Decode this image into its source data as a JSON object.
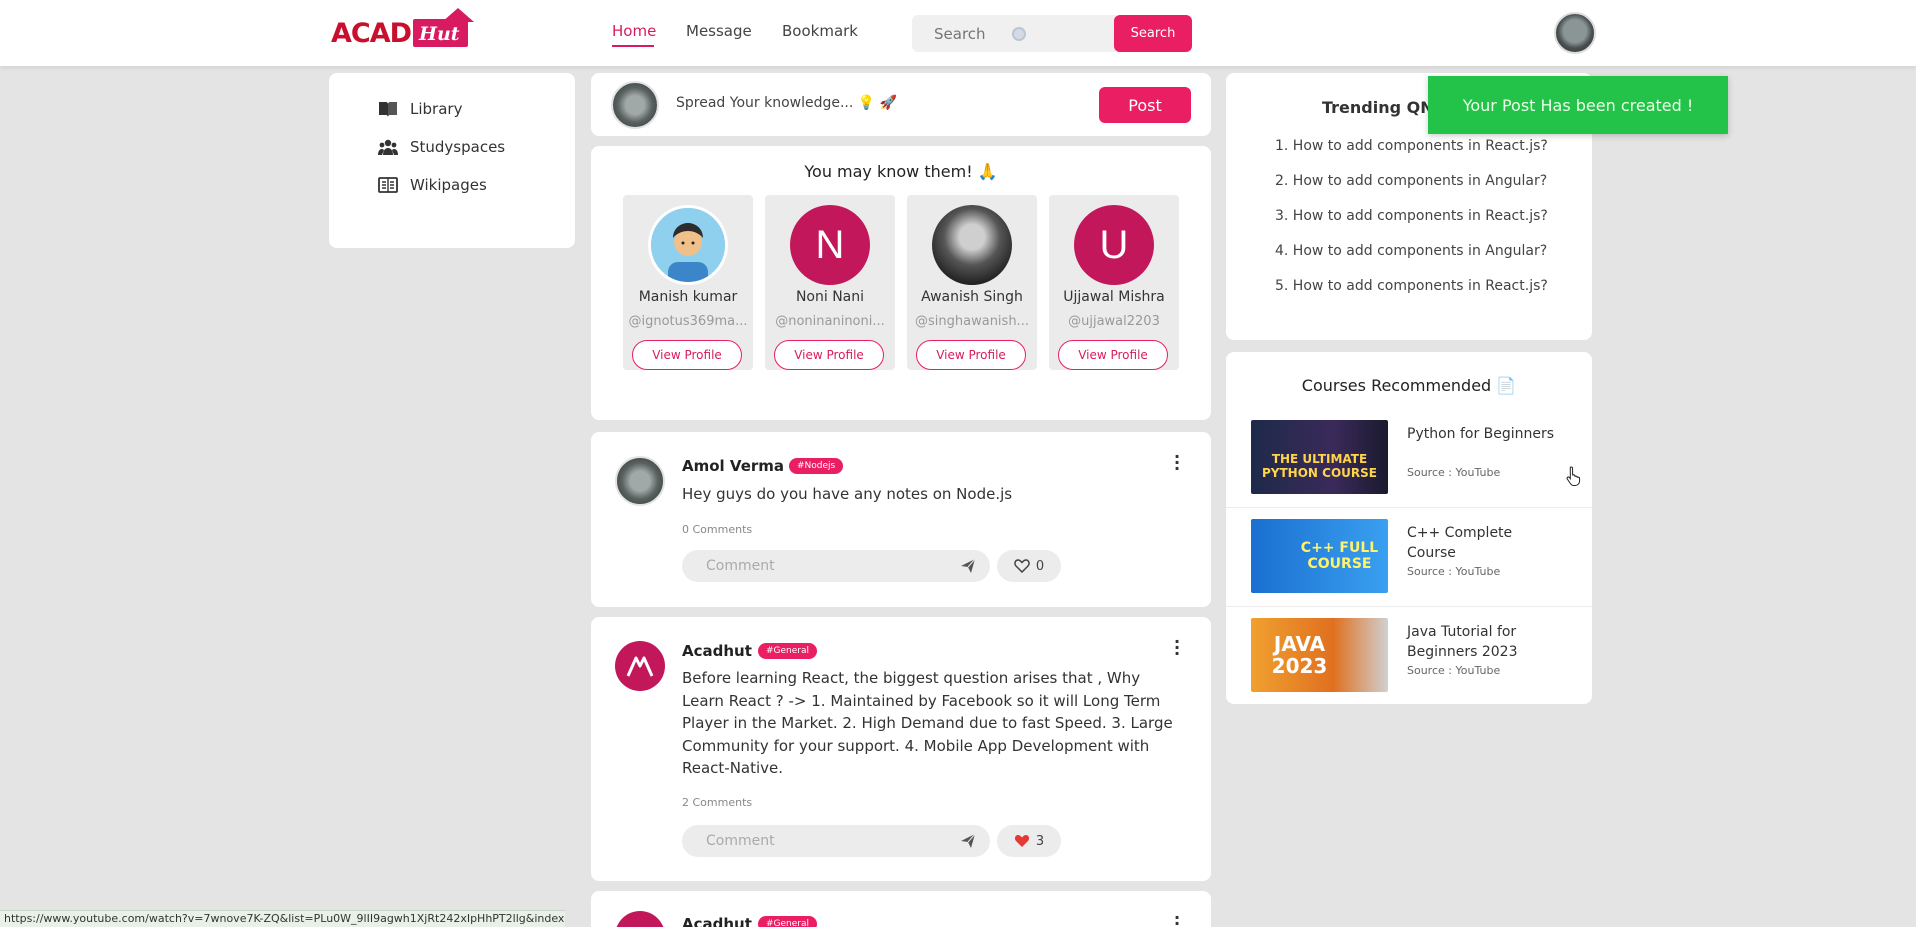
{
  "header": {
    "logo_acad": "ACAD",
    "logo_hut": "Hut",
    "nav": [
      "Home",
      "Message",
      "Bookmark"
    ],
    "search_placeholder": "Search",
    "search_button": "Search"
  },
  "sidebar": {
    "items": [
      {
        "label": "Library",
        "icon": "book-icon"
      },
      {
        "label": "Studyspaces",
        "icon": "group-icon"
      },
      {
        "label": "Wikipages",
        "icon": "wiki-icon"
      }
    ]
  },
  "composer": {
    "placeholder": "Spread Your knowledge... 💡 🚀",
    "post_button": "Post"
  },
  "suggestions": {
    "title": "You may know them! 🙏",
    "people": [
      {
        "name": "Manish kumar",
        "handle": "@ignotus369ma...",
        "initial": "",
        "button": "View Profile"
      },
      {
        "name": "Noni Nani",
        "handle": "@noninaninoni...",
        "initial": "N",
        "button": "View Profile"
      },
      {
        "name": "Awanish Singh",
        "handle": "@singhawanish...",
        "initial": "",
        "button": "View Profile"
      },
      {
        "name": "Ujjawal Mishra",
        "handle": "@ujjawal2203",
        "initial": "U",
        "button": "View Profile"
      }
    ]
  },
  "posts": [
    {
      "author": "Amol Verma",
      "tag": "#Nodejs",
      "body": "Hey guys do you have any notes on Node.js",
      "comments": "0 Comments",
      "comment_placeholder": "Comment",
      "likes": "0"
    },
    {
      "author": "Acadhut",
      "tag": "#General",
      "body": "Before learning React, the biggest question arises that , Why Learn React ? -> 1. Maintained by Facebook so it will Long Term Player in the Market. 2. High Demand due to fast Speed. 3. Large Community for your support. 4. Mobile App Development with React-Native.",
      "comments": "2 Comments",
      "comment_placeholder": "Comment",
      "likes": "3"
    },
    {
      "author": "Acadhut",
      "tag": "#General"
    }
  ],
  "trending": {
    "title": "Trending QNA",
    "items": [
      "1. How to add components in React.js?",
      "2. How to add components in Angular?",
      "3. How to add components in React.js?",
      "4. How to add components in Angular?",
      "5. How to add components in React.js?"
    ]
  },
  "courses": {
    "title": "Courses Recommended 📄",
    "items": [
      {
        "name": "Python for Beginners",
        "source": "Source : YouTube",
        "thumb_text": "THE ULTIMATE PYTHON COURSE"
      },
      {
        "name": "C++ Complete Course",
        "source": "Source : YouTube",
        "thumb_text": "C++ FULL COURSE"
      },
      {
        "name": "Java Tutorial for Beginners 2023",
        "source": "Source : YouTube",
        "thumb_text": "JAVA 2023"
      }
    ]
  },
  "toast": "Your Post Has been created !",
  "status_url": "https://www.youtube.com/watch?v=7wnove7K-ZQ&list=PLu0W_9lII9agwh1XjRt242xIpHhPT2llg&index=1",
  "colors": {
    "accent": "#e91e63",
    "brand": "#c8102e",
    "toast": "#22c348"
  }
}
